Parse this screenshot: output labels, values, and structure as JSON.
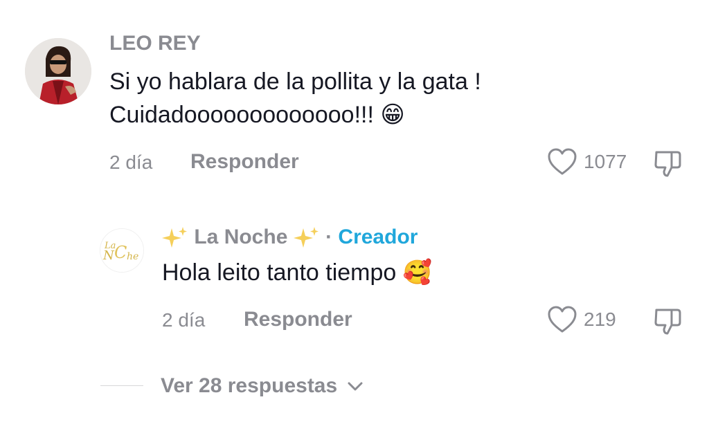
{
  "comment": {
    "username": "LEO REY",
    "text_line1": "Si yo hablara de la pollita y la gata !",
    "text_line2": "Cuidadooooooooooooo!!!",
    "emoji": "😁",
    "time": "2 día",
    "reply_label": "Responder",
    "likes": "1077"
  },
  "reply": {
    "username": "La Noche",
    "separator": "·",
    "creator_label": "Creador",
    "text": "Hola leito tanto tiempo",
    "emoji": "🥰",
    "time": "2 día",
    "reply_label": "Responder",
    "likes": "219",
    "avatar_logo_text": "La Noche"
  },
  "view_replies_label": "Ver 28 respuestas",
  "colors": {
    "text": "#161823",
    "muted": "#8a8b91",
    "creator": "#20a7db",
    "sparkle": "#f5cf5a"
  },
  "icons": [
    "heart-outline-icon",
    "thumbs-down-icon",
    "sparkles-icon",
    "chevron-down-icon"
  ]
}
